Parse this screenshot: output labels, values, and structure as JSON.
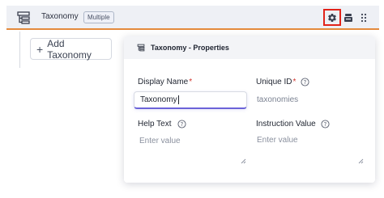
{
  "header": {
    "title": "Taxonomy",
    "badge": "Multiple"
  },
  "toolbar": {
    "add_label": "Add Taxonomy"
  },
  "panel": {
    "title": "Taxonomy - Properties",
    "display_name": {
      "label": "Display Name",
      "required": "*",
      "value": "Taxonomy"
    },
    "unique_id": {
      "label": "Unique ID",
      "required": "*",
      "value": "taxonomies"
    },
    "help_text": {
      "label": "Help Text",
      "placeholder": "Enter value"
    },
    "instruction_value": {
      "label": "Instruction Value",
      "placeholder": "Enter value"
    }
  },
  "colors": {
    "accent_border": "#e48a3c",
    "highlight_box": "#e2231a",
    "focus_underline": "#6b63d9",
    "required": "#d0332b"
  },
  "icons": [
    "taxonomy-icon",
    "gear-icon",
    "stack-icon",
    "drag-handle-icon",
    "plus-icon",
    "info-icon",
    "resize-handle-icon"
  ]
}
